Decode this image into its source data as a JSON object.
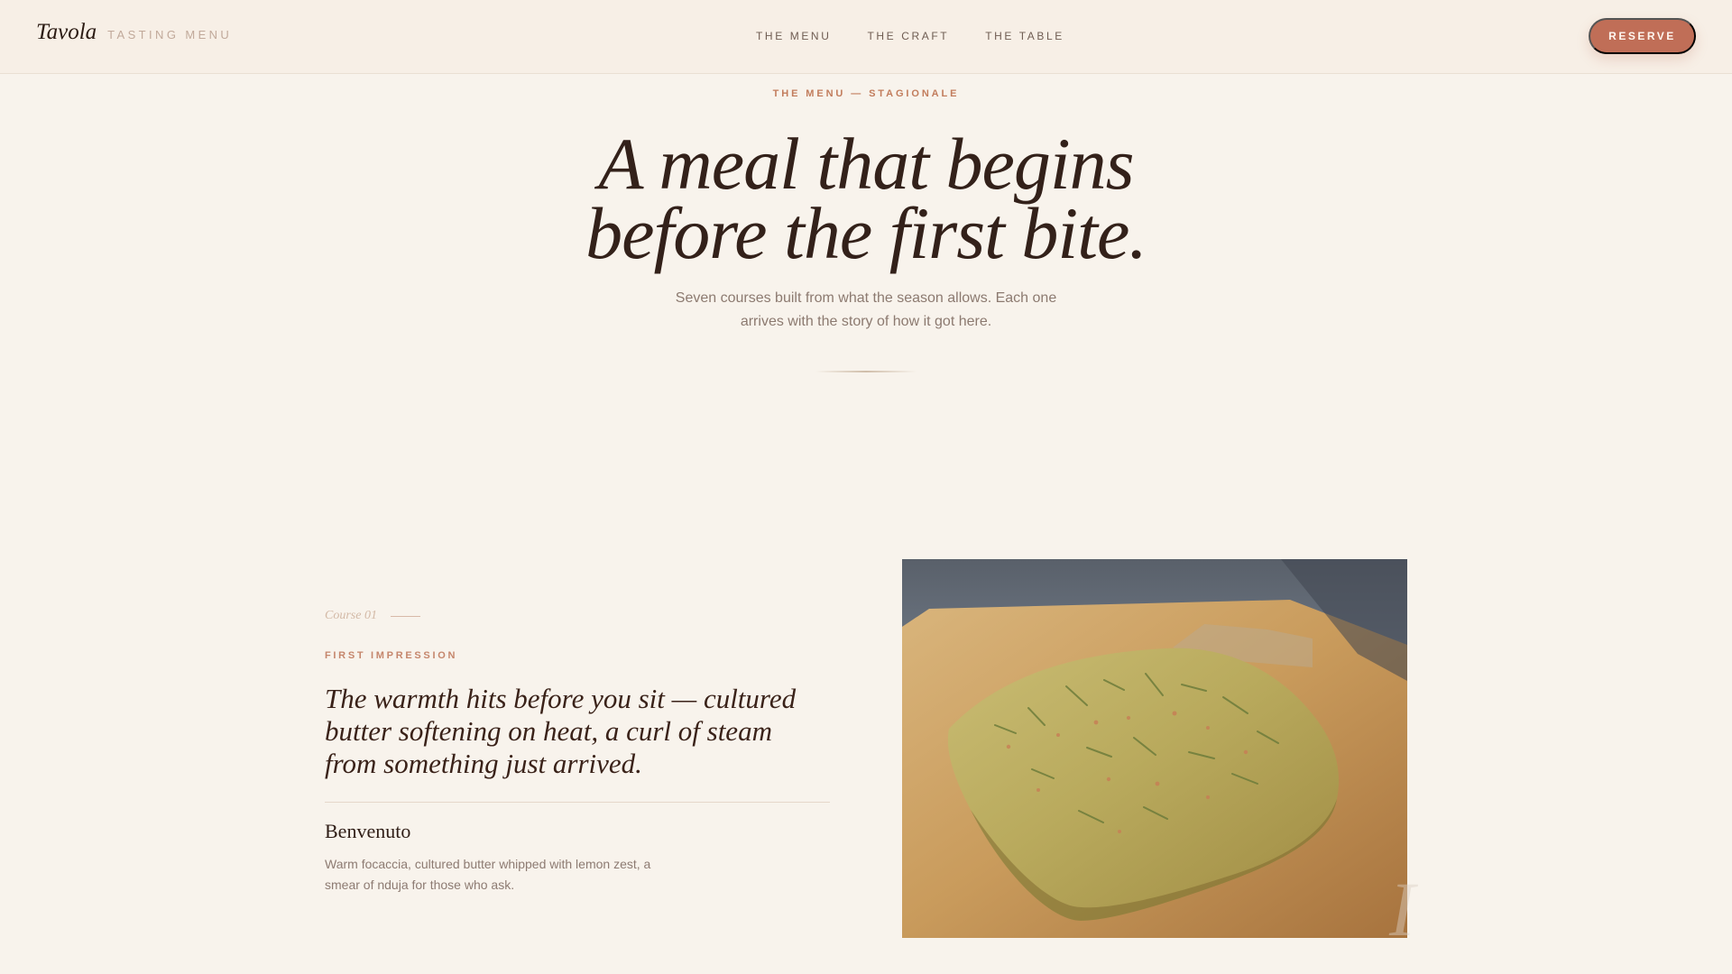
{
  "header": {
    "brand": "Tavola",
    "subtitle": "TASTING MENU",
    "nav": [
      {
        "label": "THE MENU"
      },
      {
        "label": "THE CRAFT"
      },
      {
        "label": "THE TABLE"
      }
    ],
    "reserve_label": "RESERVE"
  },
  "hero": {
    "eyebrow": "THE MENU — STAGIONALE",
    "headline_line_1": "A meal that begins",
    "headline_line_2": "before the first bite.",
    "intro": "Seven courses built from what the season allows. Each one arrives with the story of how it got here."
  },
  "course": {
    "number": "Course 01",
    "kicker": "FIRST IMPRESSION",
    "quote": "The warmth hits before you sit — cultured butter softening on heat, a curl of steam from something just arrived.",
    "dish_title": "Benvenuto",
    "dish_description": "Warm focaccia, cultured butter whipped with lemon zest, a smear of nduja for those who ask.",
    "watermark": "I"
  },
  "colors": {
    "background": "#f8f3ec",
    "accent": "#c06e57",
    "ink": "#33211a",
    "muted": "#8c7a70"
  }
}
